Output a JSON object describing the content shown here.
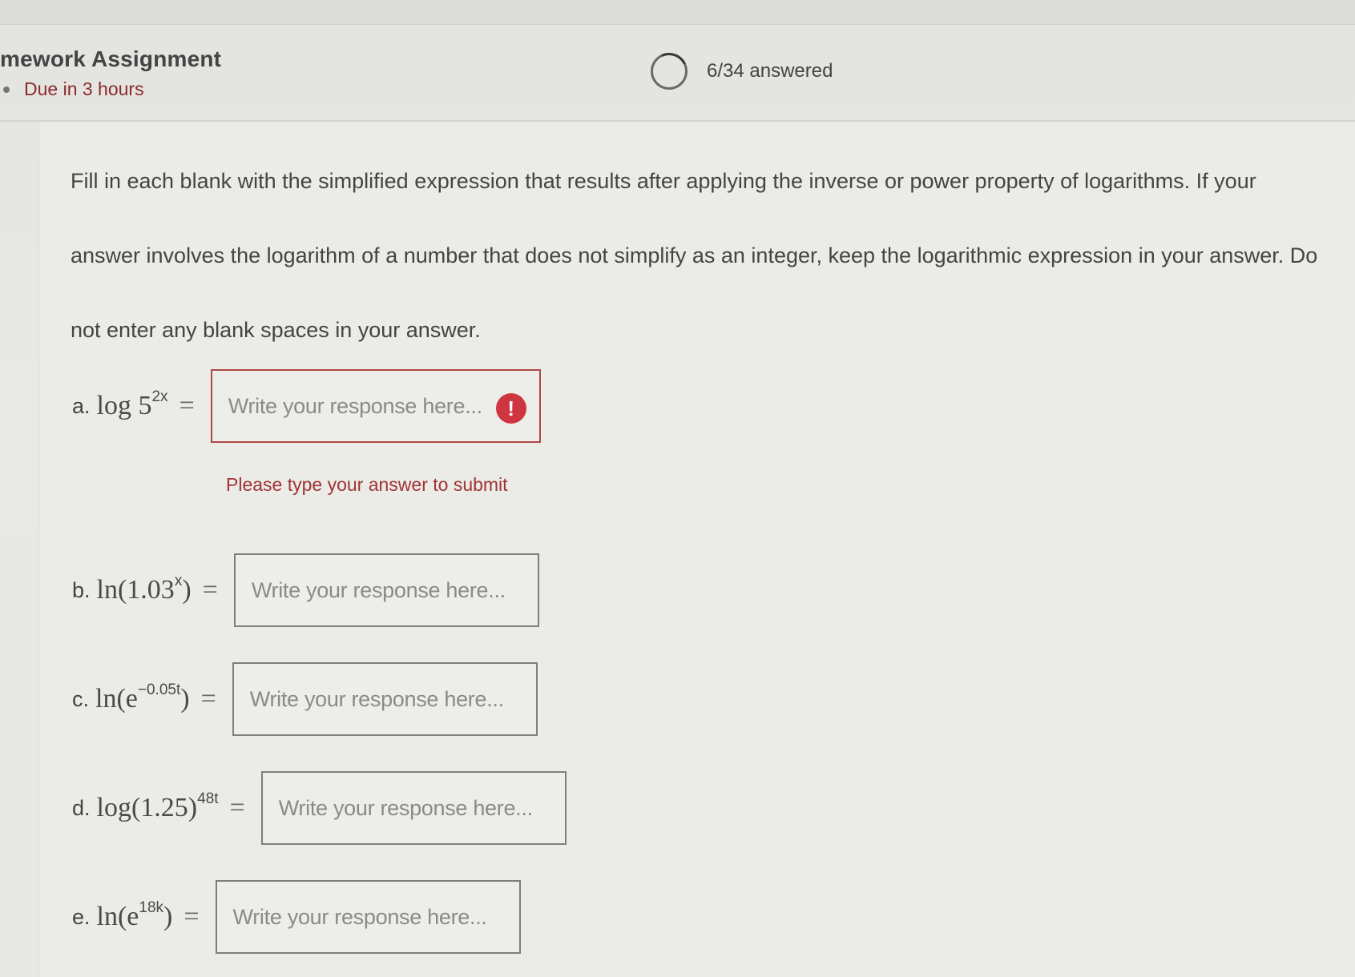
{
  "header": {
    "title": "mework Assignment",
    "due": "Due in 3 hours",
    "progress": "6/34 answered"
  },
  "instructions": {
    "line1": "Fill in each blank with the simplified expression that results after applying the inverse or power property of logarithms. If your",
    "line2": "answer involves the logarithm of a number that does not simplify as an integer, keep the logarithmic expression in your answer. Do",
    "line3": "not enter any blank spaces in your answer."
  },
  "questions": [
    {
      "letter": "a.",
      "base": "log 5",
      "exp": "2x",
      "tail": "",
      "eq": "=",
      "placeholder": "Write your response here..."
    },
    {
      "letter": "b.",
      "base": "ln(1.03",
      "exp": "x",
      "tail": ")",
      "eq": "=",
      "placeholder": "Write your response here..."
    },
    {
      "letter": "c.",
      "base": "ln(e",
      "exp": "−0.05t",
      "tail": ")",
      "eq": "=",
      "placeholder": "Write your response here..."
    },
    {
      "letter": "d.",
      "base": "log(1.25)",
      "exp": "48t",
      "tail": "",
      "eq": "=",
      "placeholder": "Write your response here..."
    },
    {
      "letter": "e.",
      "base": "ln(e",
      "exp": "18k",
      "tail": ")",
      "eq": "=",
      "placeholder": "Write your response here..."
    }
  ],
  "error": {
    "message": "Please type your answer to submit",
    "icon": "exclamation-icon",
    "color": "#cf3540"
  }
}
